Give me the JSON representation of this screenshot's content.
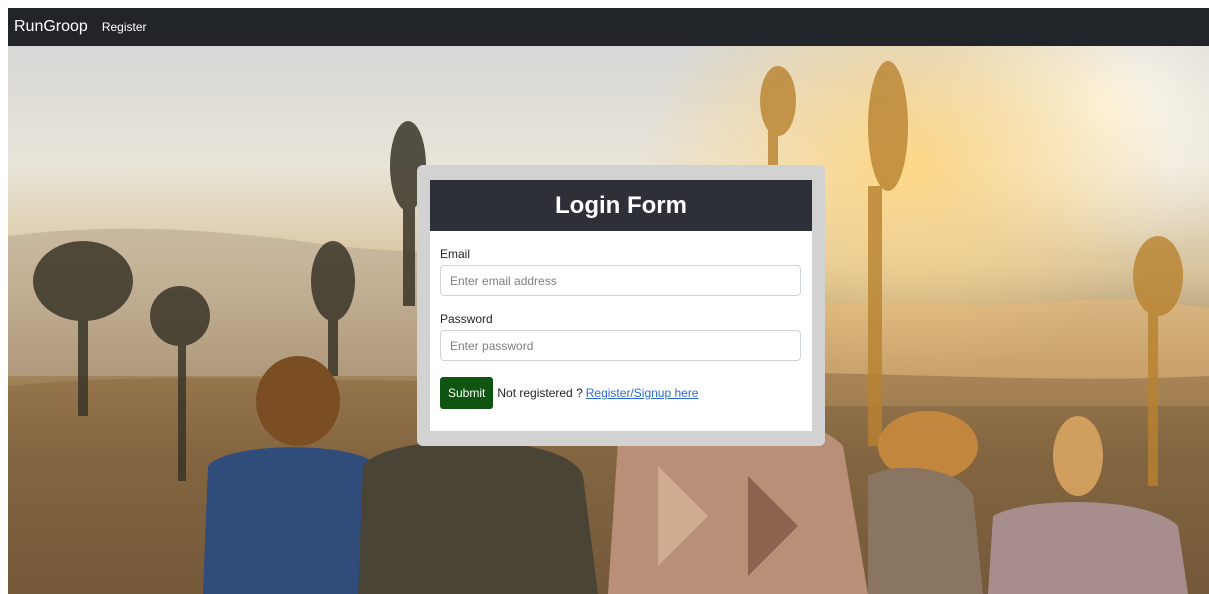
{
  "navbar": {
    "brand": "RunGroop",
    "links": [
      {
        "label": "Register"
      }
    ]
  },
  "login": {
    "title": "Login Form",
    "email": {
      "label": "Email",
      "placeholder": "Enter email address",
      "value": ""
    },
    "password": {
      "label": "Password",
      "placeholder": "Enter password",
      "value": ""
    },
    "submit_label": "Submit",
    "signup_prompt": "Not registered ?",
    "signup_link": "Register/Signup here"
  },
  "colors": {
    "navbar_bg": "#212529",
    "card_header_bg": "#2d3137",
    "submit_bg": "#0f5410",
    "link": "#2c6bd4"
  }
}
